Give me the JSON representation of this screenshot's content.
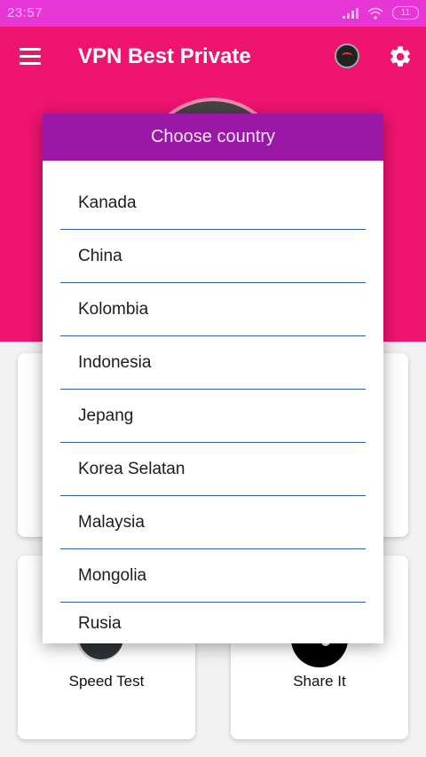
{
  "status_bar": {
    "time": "23:57",
    "battery": "11"
  },
  "app_bar": {
    "title": "VPN Best Private",
    "icons": [
      "menu-icon",
      "speedometer-icon",
      "gear-icon"
    ]
  },
  "cards": {
    "speed_test_label": "Speed Test",
    "share_label": "Share It"
  },
  "dialog": {
    "title": "Choose country",
    "countries": [
      "Kanada",
      "China",
      "Kolombia",
      "Indonesia",
      "Jepang",
      "Korea Selatan",
      "Malaysia",
      "Mongolia"
    ],
    "partial_item": "Rusia"
  },
  "colors": {
    "status_bar": "#e636d6",
    "app_bar": "#ef1470",
    "dialog_header": "#9b18a6",
    "divider": "#2d5e9a"
  }
}
